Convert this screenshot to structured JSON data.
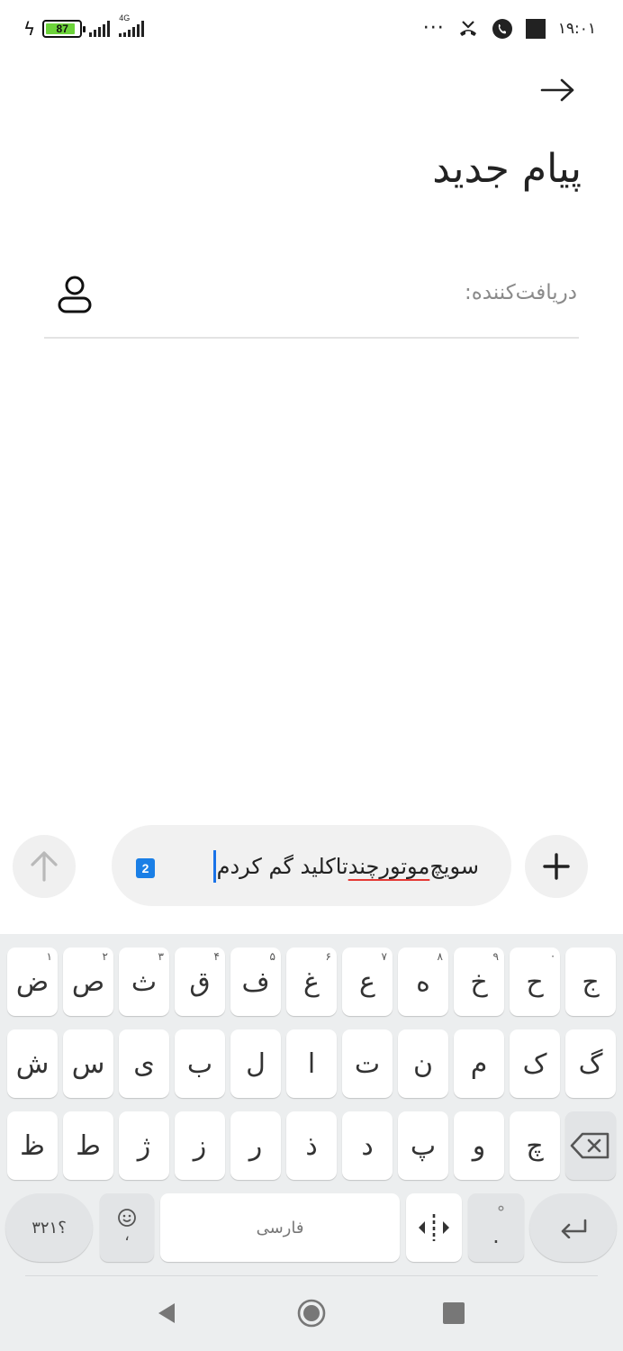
{
  "status_bar": {
    "battery_percent": "87",
    "battery_level": 0.87,
    "network_type": "4G",
    "more_indicator": "···",
    "time": "۱۹:۰۱",
    "icons": [
      "charging-bolt-icon",
      "battery-icon",
      "signal-sim1-icon",
      "signal-sim2-icon",
      "missed-call-icon",
      "viber-icon",
      "notification-square-icon"
    ]
  },
  "header": {
    "back_icon": "arrow-right-icon",
    "title": "پیام جدید"
  },
  "recipient": {
    "label": "دریافت‌کننده:",
    "icon": "contact-person-icon"
  },
  "compose": {
    "sim_badge": "2",
    "text_part1": "سویچ ",
    "text_misspelled": "موتورچند",
    "text_part2": " تاکلید گم کردم",
    "attach_icon": "plus-icon",
    "send_icon": "arrow-up-icon"
  },
  "keyboard": {
    "row1": [
      {
        "label": "ج",
        "hint": ""
      },
      {
        "label": "ح",
        "hint": "·"
      },
      {
        "label": "خ",
        "hint": "۹"
      },
      {
        "label": "ه",
        "hint": "۸"
      },
      {
        "label": "ع",
        "hint": "۷"
      },
      {
        "label": "غ",
        "hint": "۶"
      },
      {
        "label": "ف",
        "hint": "۵"
      },
      {
        "label": "ق",
        "hint": "۴"
      },
      {
        "label": "ث",
        "hint": "۳"
      },
      {
        "label": "ص",
        "hint": "۲"
      },
      {
        "label": "ض",
        "hint": "۱"
      }
    ],
    "row2": [
      "گ",
      "ک",
      "م",
      "ن",
      "ت",
      "ا",
      "ل",
      "ب",
      "ی",
      "س",
      "ش"
    ],
    "row3": [
      "چ",
      "و",
      "پ",
      "د",
      "ذ",
      "ر",
      "ز",
      "ژ",
      "ط",
      "ظ"
    ],
    "numbers_label": "؟۳۲۱",
    "emoji_sub": "،",
    "space_label": "فارسی",
    "punct_top": "ْ",
    "punct_bottom": ".",
    "backspace_icon": "backspace-icon",
    "enter_icon": "enter-return-icon",
    "cursor_move_icon": "cursor-move-icon",
    "emoji_icon": "smiley-icon"
  },
  "nav_bar": {
    "back_icon": "triangle-back-icon",
    "home_icon": "circle-home-icon",
    "recents_icon": "square-recents-icon"
  }
}
